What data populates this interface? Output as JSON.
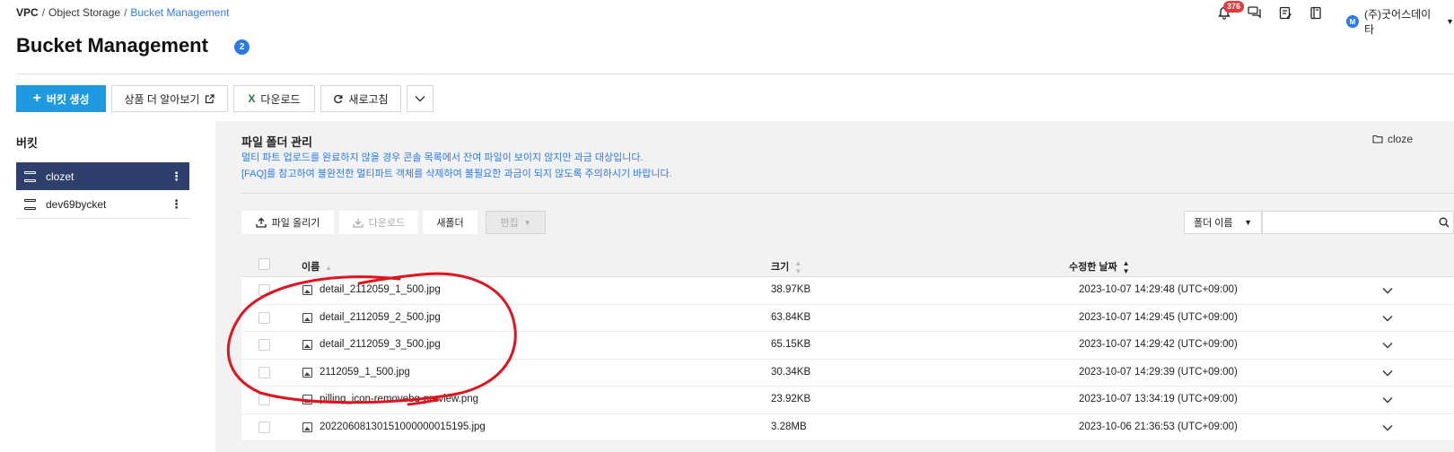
{
  "breadcrumb": {
    "first": "VPC",
    "middle": "Object Storage",
    "current": "Bucket Management",
    "separator": "/"
  },
  "header": {
    "notification_count": "376",
    "user_initial": "M",
    "user_name": "(주)굿어스데이타"
  },
  "page": {
    "title": "Bucket Management",
    "title_badge": "2"
  },
  "toolbar": {
    "create_bucket": "버킷 생성",
    "learn_more": "상품 더 알아보기",
    "download": "다운로드",
    "refresh": "새로고침"
  },
  "left_panel": {
    "title": "버킷",
    "buckets": [
      {
        "name": "clozet",
        "active": true
      },
      {
        "name": "dev69bycket",
        "active": false
      }
    ]
  },
  "right_panel": {
    "title": "파일 폴더 관리",
    "notice_line1": "멀티 파트 업로드를 완료하지 않을 경우 콘솔 목록에서 잔여 파일이 보이지 않지만 과금 대상입니다.",
    "notice_line2": "[FAQ]를 참고하여 불완전한 멀티파트 객체를 삭제하여 불필요한 과금이 되지 않도록 주의하시기 바랍니다.",
    "current_folder": "cloze",
    "upload": "파일 올리기",
    "download": "다운로드",
    "new_folder": "새폴더",
    "edit": "편집",
    "search_by": "폴더 이름",
    "search_placeholder": ""
  },
  "table": {
    "columns": {
      "name": "이름",
      "size": "크기",
      "modified": "수정한 날짜"
    },
    "rows": [
      {
        "name": "detail_2112059_1_500.jpg",
        "size": "38.97KB",
        "modified": "2023-10-07 14:29:48 (UTC+09:00)"
      },
      {
        "name": "detail_2112059_2_500.jpg",
        "size": "63.84KB",
        "modified": "2023-10-07 14:29:45 (UTC+09:00)"
      },
      {
        "name": "detail_2112059_3_500.jpg",
        "size": "65.15KB",
        "modified": "2023-10-07 14:29:42 (UTC+09:00)"
      },
      {
        "name": "2112059_1_500.jpg",
        "size": "30.34KB",
        "modified": "2023-10-07 14:29:39 (UTC+09:00)"
      },
      {
        "name": "pilling_icon-removebg-preview.png",
        "size": "23.92KB",
        "modified": "2023-10-07 13:34:19 (UTC+09:00)"
      },
      {
        "name": "20220608130151000000015195.jpg",
        "size": "3.28MB",
        "modified": "2023-10-06 21:36:53 (UTC+09:00)"
      }
    ]
  },
  "colors": {
    "primary": "#1f9ae0",
    "active_bucket": "#2f3f6b",
    "link": "#2c7be5",
    "badge": "#e5393a",
    "annotation": "#e0141e"
  }
}
